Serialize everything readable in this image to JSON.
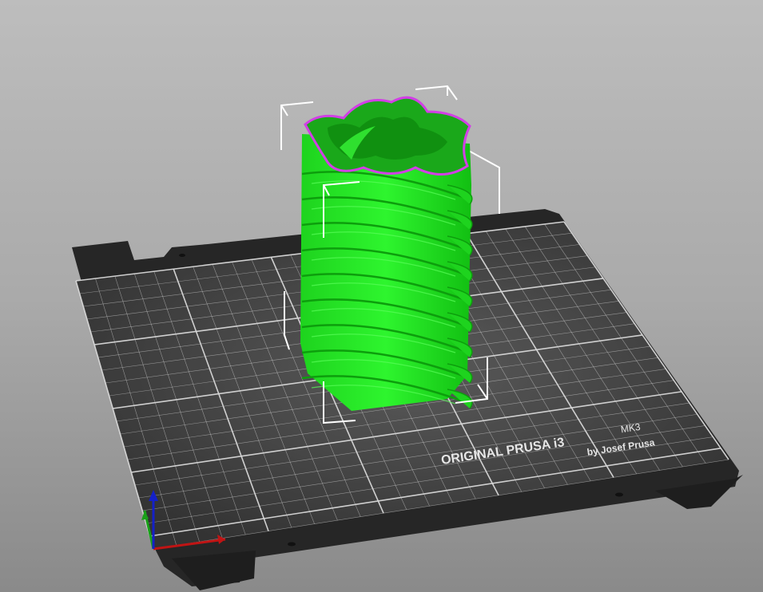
{
  "app": {
    "view": "3D editor plater"
  },
  "bed": {
    "brand_line": "ORIGINAL PRUSA i3",
    "model_label": "MK3",
    "maker_line": "by Josef Prusa",
    "surface_color": "#3a3a3a",
    "frame_color": "#262626",
    "grid_color": "#d8d8d8"
  },
  "object": {
    "name": "twisted vase",
    "color": "#19e619",
    "rim_color": "#d23fe6",
    "selected": true,
    "rib_count": 9
  },
  "axes": {
    "x_color": "#c01414",
    "y_color": "#19a019",
    "z_color": "#1420c8"
  },
  "background": {
    "top": "#bdbdbd",
    "bottom": "#8a8a8a"
  }
}
